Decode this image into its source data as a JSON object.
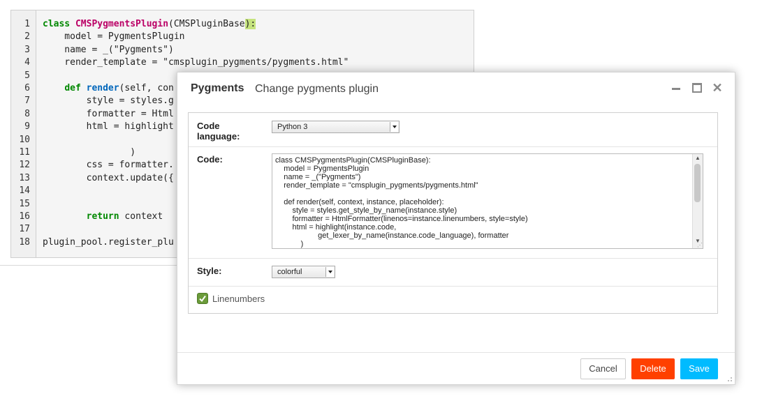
{
  "background_code": {
    "line_numbers": [
      "1",
      "2",
      "3",
      "4",
      "5",
      "6",
      "7",
      "8",
      "9",
      "10",
      "11",
      "12",
      "13",
      "14",
      "15",
      "16",
      "17",
      "18"
    ],
    "lines": [
      [
        {
          "t": "class ",
          "c": "kw"
        },
        {
          "t": "CMSPygmentsPlugin",
          "c": "cls"
        },
        {
          "t": "(CMSPluginBase",
          "c": ""
        },
        {
          "t": "):",
          "c": "hl"
        }
      ],
      [
        {
          "t": "    model = PygmentsPlugin",
          "c": ""
        }
      ],
      [
        {
          "t": "    name = _(\"Pygments\")",
          "c": ""
        }
      ],
      [
        {
          "t": "    render_template = \"cmsplugin_pygments/pygments.html\"",
          "c": ""
        }
      ],
      [
        {
          "t": "",
          "c": ""
        }
      ],
      [
        {
          "t": "    ",
          "c": ""
        },
        {
          "t": "def ",
          "c": "kw"
        },
        {
          "t": "render",
          "c": "fn"
        },
        {
          "t": "(self, con",
          "c": ""
        }
      ],
      [
        {
          "t": "        style = styles.g",
          "c": ""
        }
      ],
      [
        {
          "t": "        formatter = Html",
          "c": ""
        }
      ],
      [
        {
          "t": "        html = highlight",
          "c": ""
        }
      ],
      [
        {
          "t": "",
          "c": ""
        }
      ],
      [
        {
          "t": "                )",
          "c": ""
        }
      ],
      [
        {
          "t": "        css = formatter.",
          "c": ""
        }
      ],
      [
        {
          "t": "        context.update({",
          "c": ""
        }
      ],
      [
        {
          "t": "",
          "c": ""
        }
      ],
      [
        {
          "t": "",
          "c": ""
        }
      ],
      [
        {
          "t": "        ",
          "c": ""
        },
        {
          "t": "return ",
          "c": "kw"
        },
        {
          "t": "context",
          "c": ""
        }
      ],
      [
        {
          "t": "",
          "c": ""
        }
      ],
      [
        {
          "t": "plugin_pool.register_plu",
          "c": ""
        }
      ]
    ]
  },
  "modal": {
    "title": "Pygments",
    "subtitle": "Change pygments plugin",
    "fields": {
      "code_language_label": "Code language:",
      "code_language_value": "Python 3",
      "code_label": "Code:",
      "code_value_lines": [
        "class CMSPygmentsPlugin(CMSPluginBase):",
        "    model = PygmentsPlugin",
        "    name = _(\"Pygments\")",
        "    render_template = \"cmsplugin_pygments/pygments.html\"",
        "",
        "    def render(self, context, instance, placeholder):",
        "        style = styles.get_style_by_name(instance.style)",
        "        formatter = HtmlFormatter(linenos=instance.linenumbers, style=style)",
        "        html = highlight(instance.code,",
        "                    get_lexer_by_name(instance.code_language), formatter",
        "            )"
      ],
      "style_label": "Style:",
      "style_value": "colorful",
      "linenumbers_label": "Linenumbers",
      "linenumbers_checked": true
    },
    "footer": {
      "cancel_label": "Cancel",
      "delete_label": "Delete",
      "save_label": "Save"
    }
  }
}
